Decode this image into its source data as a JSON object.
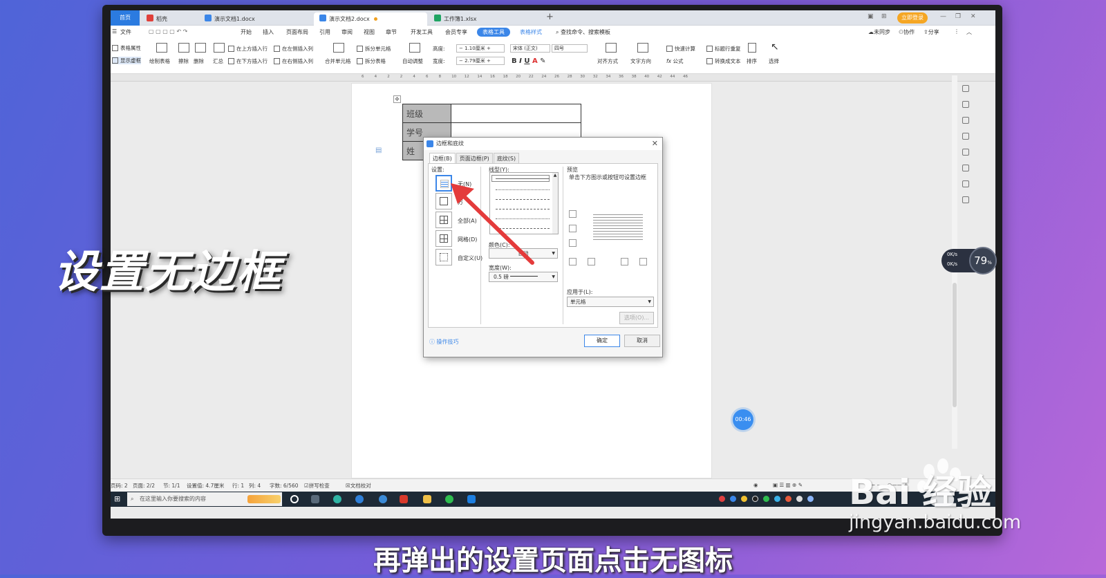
{
  "browser_tabs": [
    {
      "label": "首页"
    },
    {
      "label": "稻壳"
    },
    {
      "label": "演示文档1.docx"
    },
    {
      "label": "演示文档2.docx"
    },
    {
      "label": "工作簿1.xlsx"
    }
  ],
  "login_label": "立即登录",
  "menu": {
    "file": "文件",
    "items": [
      "开始",
      "插入",
      "页面布局",
      "引用",
      "审阅",
      "视图",
      "章节",
      "开发工具",
      "会员专享"
    ],
    "table_tools": "表格工具",
    "table_style": "表格样式",
    "search": "查找命令、搜索模板",
    "sync": "未同步",
    "collab": "协作",
    "share": "分享"
  },
  "ribbon": {
    "table_props": "表格属性",
    "show_grid": "显示虚框",
    "draw_table": "绘制表格",
    "erase": "擦除",
    "delete": "删除",
    "summary": "汇总",
    "insert_above": "在上方插入行",
    "insert_below": "在下方插入行",
    "insert_left": "在左侧插入列",
    "insert_right": "在右侧插入列",
    "merge": "合并单元格",
    "split_cell": "拆分单元格",
    "split_table": "拆分表格",
    "autofit": "自动调整",
    "height_label": "高度:",
    "height_value": "1.10厘米",
    "width_label": "宽度:",
    "width_value": "2.79厘米",
    "font": "宋体 (正文)",
    "size": "四号",
    "align": "对齐方式",
    "text_dir": "文字方向",
    "quick_calc": "快速计算",
    "repeat_title": "标题行重复",
    "formula": "公式",
    "to_text": "转换成文本",
    "sort": "排序",
    "select": "选择"
  },
  "ruler_numbers": [
    "6",
    "4",
    "2",
    "2",
    "4",
    "6",
    "8",
    "10",
    "12",
    "14",
    "16",
    "18",
    "20",
    "22",
    "24",
    "26",
    "28",
    "30",
    "32",
    "34",
    "36",
    "38",
    "40",
    "42",
    "44",
    "46"
  ],
  "table_rows": [
    "班级",
    "学号",
    "姓"
  ],
  "dialog": {
    "title": "边框和底纹",
    "tabs": [
      "边框(B)",
      "页面边框(P)",
      "底纹(S)"
    ],
    "setting_label": "设置:",
    "settings": [
      "无(N)",
      "方",
      "全部(A)",
      "网格(D)",
      "自定义(U)"
    ],
    "line_style_label": "线型(Y):",
    "color_label": "颜色(C):",
    "color_value": "自动",
    "width_label": "宽度(W):",
    "width_value": "0.5",
    "width_unit": "磅",
    "preview_label": "预览",
    "preview_hint": "单击下方图示或按钮可设置边框",
    "apply_label": "应用于(L):",
    "apply_value": "单元格",
    "options_btn": "选项(O)...",
    "tips": "操作技巧",
    "ok": "确定",
    "cancel": "取消"
  },
  "statusbar": {
    "page_num": "页码: 2",
    "pages": "页面: 2/2",
    "section": "节: 1/1",
    "setting": "设置值: 4.7厘米",
    "row": "行: 1",
    "col": "列: 4",
    "words": "字数: 6/560",
    "spell": "拼写检查",
    "proof": "文档校对"
  },
  "taskbar_search": "在这里输入你要搜索的内容",
  "timer": "00:46",
  "net_widget": {
    "percent": "79",
    "up": "0K/s",
    "down": "0K/s"
  },
  "overlay_title": "设置无边框",
  "caption": "再弹出的设置页面点击无图标",
  "watermark": {
    "logo": "Bai 经验",
    "url": "jingyan.baidu.com"
  }
}
